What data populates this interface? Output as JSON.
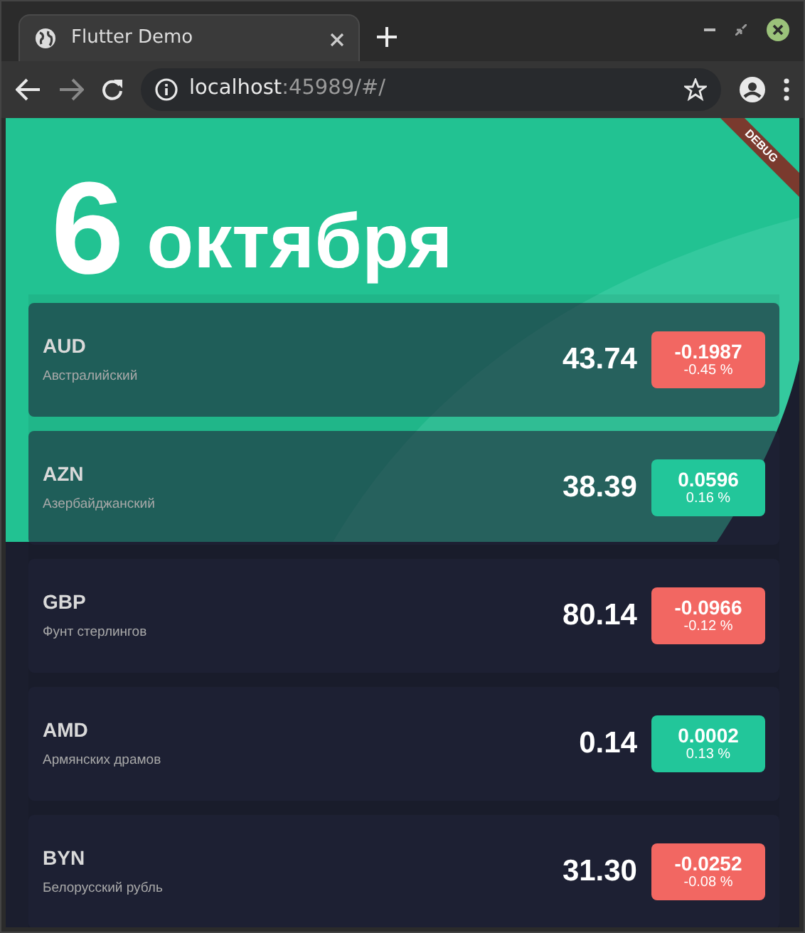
{
  "browser": {
    "tab_title": "Flutter Demo",
    "url_host": "localhost",
    "url_rest": ":45989/#/"
  },
  "header": {
    "day": "6",
    "month": "октября"
  },
  "debug_banner": "DEBUG",
  "rates": [
    {
      "code": "AUD",
      "name": "Австралийский",
      "value": "43.74",
      "change": "-0.1987",
      "percent": "-0.45 %",
      "color": "#f26762"
    },
    {
      "code": "AZN",
      "name": "Азербайджанский",
      "value": "38.39",
      "change": "0.0596",
      "percent": "0.16 %",
      "color": "#22c69a"
    },
    {
      "code": "GBP",
      "name": "Фунт стерлингов",
      "value": "80.14",
      "change": "-0.0966",
      "percent": "-0.12 %",
      "color": "#f26762"
    },
    {
      "code": "AMD",
      "name": "Армянских драмов",
      "value": "0.14",
      "change": "0.0002",
      "percent": "0.13 %",
      "color": "#22c69a"
    },
    {
      "code": "BYN",
      "name": "Белорусский рубль",
      "value": "31.30",
      "change": "-0.0252",
      "percent": "-0.08 %",
      "color": "#f26762"
    }
  ]
}
